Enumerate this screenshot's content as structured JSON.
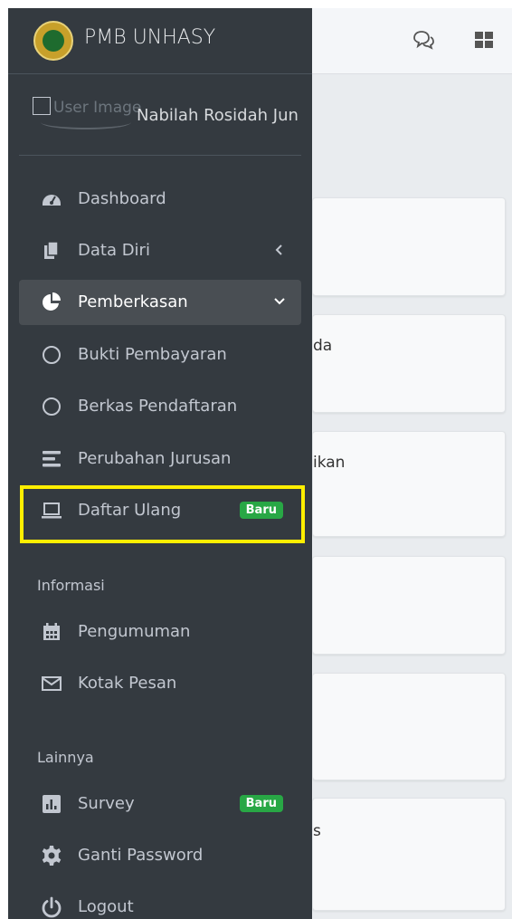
{
  "brand": {
    "title": "PMB UNHASY"
  },
  "user": {
    "image_alt": "User Image",
    "name": "Nabilah Rosidah Jun"
  },
  "menu": {
    "dashboard": "Dashboard",
    "data_diri": "Data Diri",
    "pemberkasan": "Pemberkasan",
    "bukti_pembayaran": "Bukti Pembayaran",
    "berkas_pendaftaran": "Berkas Pendaftaran",
    "perubahan_jurusan": "Perubahan Jurusan",
    "daftar_ulang": "Daftar Ulang",
    "daftar_ulang_badge": "Baru"
  },
  "sections": {
    "informasi": "Informasi",
    "lainnya": "Lainnya"
  },
  "informasi": {
    "pengumuman": "Pengumuman",
    "kotak_pesan": "Kotak Pesan"
  },
  "lainnya": {
    "survey": "Survey",
    "survey_badge": "Baru",
    "ganti_password": "Ganti Password",
    "logout": "Logout"
  },
  "background": {
    "frag1": "da",
    "frag2": "ikan",
    "frag3": "s"
  },
  "colors": {
    "sidebar": "#343a40",
    "active": "#494e53",
    "badge": "#28a745",
    "highlight": "#ffee00"
  }
}
